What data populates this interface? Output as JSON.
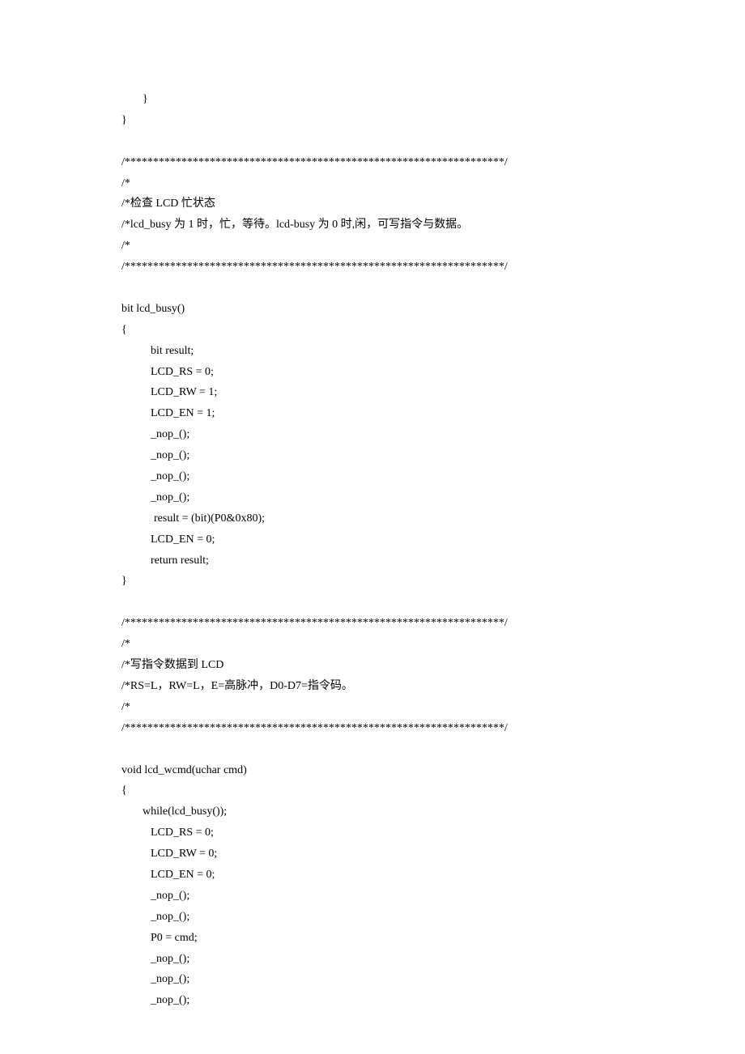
{
  "lines": [
    {
      "cls": "indent-1",
      "text": "}"
    },
    {
      "cls": "",
      "text": "}"
    },
    {
      "cls": "blank",
      "text": ""
    },
    {
      "cls": "",
      "text": "/*******************************************************************/"
    },
    {
      "cls": "",
      "text": "/*"
    },
    {
      "cls": "",
      "text": "/*检查 LCD 忙状态"
    },
    {
      "cls": "",
      "text": "/*lcd_busy 为 1 时，忙，等待。lcd-busy 为 0 时,闲，可写指令与数据。"
    },
    {
      "cls": "",
      "text": "/*"
    },
    {
      "cls": "",
      "text": "/*******************************************************************/"
    },
    {
      "cls": "blank",
      "text": ""
    },
    {
      "cls": "",
      "text": "bit lcd_busy()"
    },
    {
      "cls": "",
      "text": "{"
    },
    {
      "cls": "indent-2",
      "text": "bit result;"
    },
    {
      "cls": "indent-2",
      "text": "LCD_RS = 0;"
    },
    {
      "cls": "indent-2",
      "text": "LCD_RW = 1;"
    },
    {
      "cls": "indent-2",
      "text": "LCD_EN = 1;"
    },
    {
      "cls": "indent-2",
      "text": "_nop_();"
    },
    {
      "cls": "indent-2",
      "text": "_nop_();"
    },
    {
      "cls": "indent-2",
      "text": "_nop_();"
    },
    {
      "cls": "indent-2",
      "text": "_nop_();"
    },
    {
      "cls": "indent-2b",
      "text": "result = (bit)(P0&0x80);"
    },
    {
      "cls": "indent-2",
      "text": "LCD_EN = 0;"
    },
    {
      "cls": "indent-2",
      "text": "return result;"
    },
    {
      "cls": "",
      "text": "}"
    },
    {
      "cls": "blank",
      "text": ""
    },
    {
      "cls": "",
      "text": "/*******************************************************************/"
    },
    {
      "cls": "",
      "text": "/*"
    },
    {
      "cls": "",
      "text": "/*写指令数据到 LCD"
    },
    {
      "cls": "",
      "text": "/*RS=L，RW=L，E=高脉冲，D0-D7=指令码。"
    },
    {
      "cls": "",
      "text": "/*"
    },
    {
      "cls": "",
      "text": "/*******************************************************************/"
    },
    {
      "cls": "blank",
      "text": ""
    },
    {
      "cls": "",
      "text": "void lcd_wcmd(uchar cmd)"
    },
    {
      "cls": "",
      "text": "{"
    },
    {
      "cls": "indent-1",
      "text": "while(lcd_busy());"
    },
    {
      "cls": "indent-2",
      "text": "LCD_RS = 0;"
    },
    {
      "cls": "indent-2",
      "text": "LCD_RW = 0;"
    },
    {
      "cls": "indent-2",
      "text": "LCD_EN = 0;"
    },
    {
      "cls": "indent-2",
      "text": "_nop_();"
    },
    {
      "cls": "indent-2",
      "text": "_nop_();"
    },
    {
      "cls": "indent-2",
      "text": "P0 = cmd;"
    },
    {
      "cls": "indent-2",
      "text": "_nop_();"
    },
    {
      "cls": "indent-2",
      "text": "_nop_();"
    },
    {
      "cls": "indent-2",
      "text": "_nop_();"
    }
  ]
}
